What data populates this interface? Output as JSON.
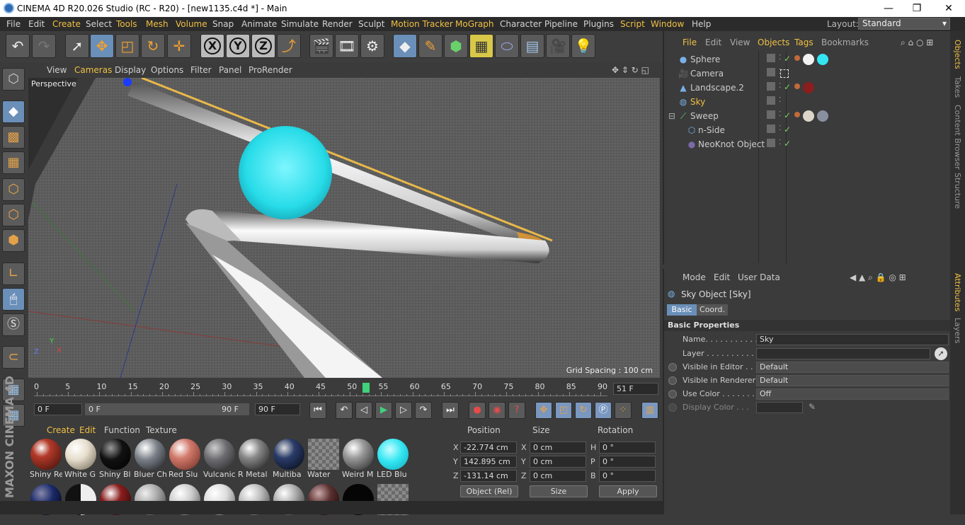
{
  "window": {
    "title": "CINEMA 4D R20.026 Studio (RC - R20) - [new1135.c4d *] - Main",
    "min": "—",
    "max": "❐",
    "close": "✕"
  },
  "menu": {
    "items": [
      "File",
      "Edit",
      "Create",
      "Select",
      "Tools",
      "Mesh",
      "Volume",
      "Snap",
      "Animate",
      "Simulate",
      "Render",
      "Sculpt",
      "Motion Tracker",
      "MoGraph",
      "Character",
      "Pipeline",
      "Plugins",
      "Script",
      "Window",
      "Help"
    ],
    "layout_label": "Layout:",
    "layout_value": "Standard"
  },
  "toolbar": {
    "x": "X",
    "y": "Y",
    "z": "Z"
  },
  "viewport": {
    "menu": [
      "View",
      "Cameras",
      "Display",
      "Options",
      "Filter",
      "Panel",
      "ProRender"
    ],
    "camera_label": "Perspective",
    "grid_spacing": "Grid Spacing : 100 cm",
    "axis_x": "X",
    "axis_y": "Y",
    "axis_z": "Z"
  },
  "timeline": {
    "ticks": [
      "0",
      "5",
      "10",
      "15",
      "20",
      "25",
      "30",
      "35",
      "40",
      "45",
      "50",
      "55",
      "60",
      "65",
      "70",
      "75",
      "80",
      "85",
      "90"
    ],
    "current_frame_marker": "51",
    "end_field": "51 F"
  },
  "transport": {
    "start": "0 F",
    "range_start": "0 F",
    "range_end": "90 F",
    "end": "90 F"
  },
  "materials": {
    "menu": [
      "Create",
      "Edit",
      "Function",
      "Texture"
    ],
    "items": [
      {
        "name": "Shiny Re",
        "color": "#b33a2a"
      },
      {
        "name": "White G",
        "color": "#e6ddcc"
      },
      {
        "name": "Shiny Bl",
        "color": "#111111"
      },
      {
        "name": "Bluer Ch",
        "color": "#7a8088"
      },
      {
        "name": "Red Slu",
        "color": "#d27a6c"
      },
      {
        "name": "Vulcanic",
        "color": "#6c6c70"
      },
      {
        "name": "R Metal",
        "color": "#888888"
      },
      {
        "name": "Multiba",
        "color": "#2a3c6a"
      },
      {
        "name": "Water",
        "color": "#7d7d7d"
      },
      {
        "name": "Weird M",
        "color": "#9a9a9a"
      },
      {
        "name": "LED Blu",
        "color": "#33e6f2"
      }
    ]
  },
  "coords": {
    "headers": [
      "Position",
      "Size",
      "Rotation"
    ],
    "rows": [
      {
        "axis": "X",
        "pos": "-22.774 cm",
        "size_axis": "X",
        "size": "0 cm",
        "rot_axis": "H",
        "rot": "0 °"
      },
      {
        "axis": "Y",
        "pos": "142.895 cm",
        "size_axis": "Y",
        "size": "0 cm",
        "rot_axis": "P",
        "rot": "0 °"
      },
      {
        "axis": "Z",
        "pos": "-131.14 cm",
        "size_axis": "Z",
        "size": "0 cm",
        "rot_axis": "B",
        "rot": "0 °"
      }
    ],
    "mode": "Object (Rel)",
    "size_mode": "Size",
    "apply": "Apply"
  },
  "objects": {
    "menu": [
      "File",
      "Edit",
      "View",
      "Objects",
      "Tags",
      "Bookmarks"
    ],
    "items": [
      {
        "name": "Sphere",
        "icon": "sphere-icon",
        "tags": [
          "#c26a3a",
          "#f2f2f2",
          "#33e6f2"
        ]
      },
      {
        "name": "Camera",
        "icon": "camera-icon",
        "tags": []
      },
      {
        "name": "Landscape.2",
        "icon": "landscape-icon",
        "tags": [
          "#c26a3a",
          "#8a1e1e"
        ]
      },
      {
        "name": "Sky",
        "icon": "sky-icon",
        "tags": []
      },
      {
        "name": "Sweep",
        "icon": "sweep-icon",
        "tags": [
          "#c26a3a",
          "#ddd6c8",
          "#8890a0"
        ]
      },
      {
        "name": "n-Side",
        "icon": "nside-icon",
        "tags": []
      },
      {
        "name": "NeoKnot Object",
        "icon": "neoknot-icon",
        "tags": []
      }
    ]
  },
  "attributes": {
    "menu": [
      "Mode",
      "Edit",
      "User Data"
    ],
    "object_title": "Sky Object [Sky]",
    "tabs": [
      "Basic",
      "Coord."
    ],
    "section": "Basic Properties",
    "fields": [
      {
        "label": "Name. . . . . . . . . . . .",
        "value": "Sky"
      },
      {
        "label": "Layer . . . . . . . . . . . .",
        "value": ""
      },
      {
        "label": "Visible in Editor . .",
        "value": "Default"
      },
      {
        "label": "Visible in Renderer",
        "value": "Default"
      },
      {
        "label": "Use Color . . . . . . .",
        "value": "Off"
      },
      {
        "label": "Display Color . . .",
        "value": ""
      }
    ]
  },
  "side_tabs": [
    "Objects",
    "Takes",
    "Content Browser",
    "Structure",
    "Attributes",
    "Layers"
  ],
  "brand": "MAXON CINEMA 4D",
  "colors": {
    "accent": "#f0c043",
    "selection": "#6a8fb8",
    "bg": "#3b3b3b"
  }
}
